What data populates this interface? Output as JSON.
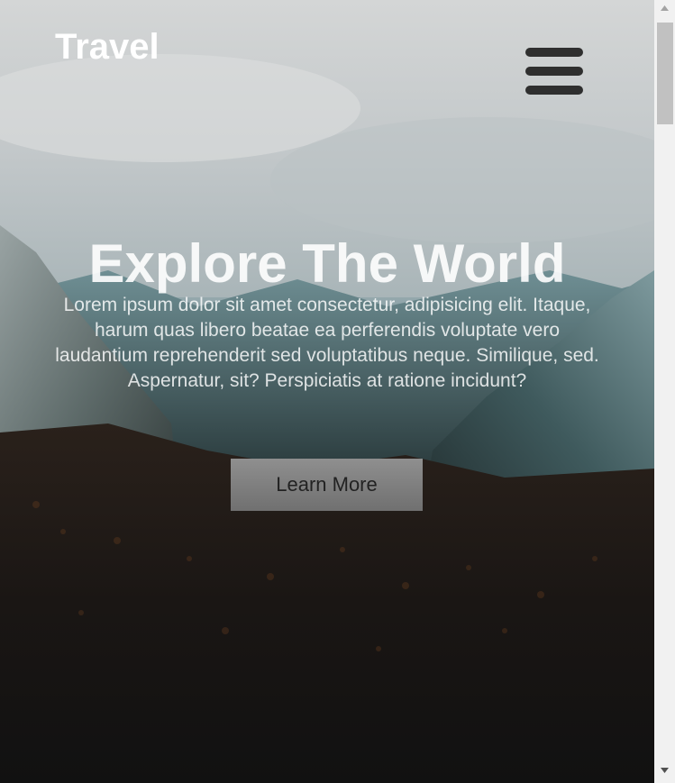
{
  "header": {
    "brand": "Travel",
    "menu_icon": "hamburger-menu-icon"
  },
  "hero": {
    "title": "Explore The World",
    "description": "Lorem ipsum dolor sit amet consectetur, adipisicing elit. Itaque, harum quas libero beatae ea perferendis voluptate vero laudantium reprehenderit sed voluptatibus neque. Similique, sed. Aspernatur, sit? Perspiciatis at ratione incidunt?",
    "cta_label": "Learn More",
    "background_icon": "mountain-forest-photo"
  },
  "scrollbar": {
    "up_icon": "scroll-up-arrow-icon",
    "down_icon": "scroll-down-arrow-icon"
  },
  "colors": {
    "text": "#ffffff",
    "menu_bar": "#2f2f2f",
    "button_bg": "#808080",
    "button_text": "#222222"
  }
}
